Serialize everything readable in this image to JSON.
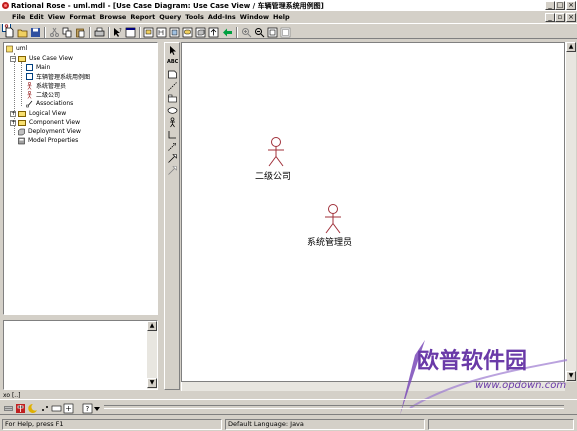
{
  "window": {
    "title": "Rational Rose - uml.mdl - [Use Case Diagram: Use Case View / 车辆管理系统用例图]"
  },
  "menu": {
    "items": [
      "File",
      "Edit",
      "View",
      "Format",
      "Browse",
      "Report",
      "Query",
      "Tools",
      "Add-Ins",
      "Window",
      "Help"
    ]
  },
  "browser": {
    "root": "uml",
    "items": [
      {
        "label": "Use Case View"
      },
      {
        "label": "Main"
      },
      {
        "label": "车辆管理系统用例图"
      },
      {
        "label": "系统管理员"
      },
      {
        "label": "二级公司"
      },
      {
        "label": "Associations"
      },
      {
        "label": "Logical View"
      },
      {
        "label": "Component View"
      },
      {
        "label": "Deployment View"
      },
      {
        "label": "Model Properties"
      }
    ]
  },
  "palette": {
    "tools": [
      "selection-tool",
      "text-tool",
      "note-tool",
      "anchor-note-tool",
      "package-tool",
      "use-case-tool",
      "actor-tool",
      "unidirectional-association-tool",
      "dependency-tool",
      "generalization-tool"
    ],
    "text_tool_label": "ABC"
  },
  "diagram": {
    "actors": [
      {
        "name": "二级公司"
      },
      {
        "name": "系统管理员"
      }
    ],
    "actor_color": "#a0303a"
  },
  "log_tab": "xo [..]",
  "statusbar": {
    "help": "For Help, press F1",
    "language": "Default Language: Java"
  },
  "watermark": {
    "text": "欧普软件园",
    "url": "www.opdown.com",
    "color": "#6a3aa8"
  }
}
